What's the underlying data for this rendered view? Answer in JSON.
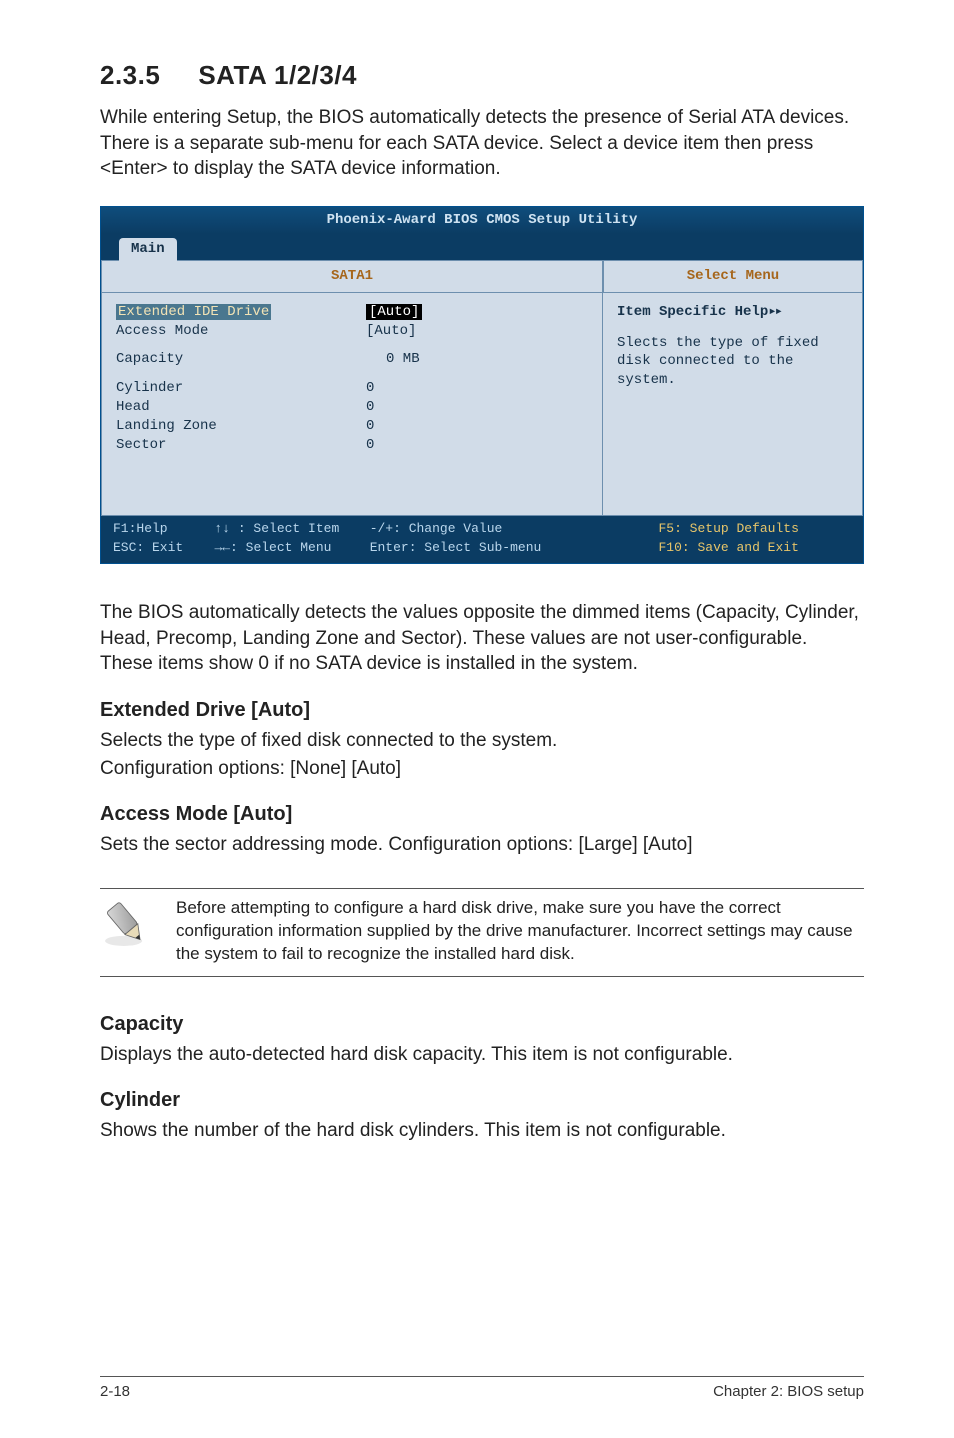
{
  "section": {
    "number": "2.3.5",
    "title": "SATA 1/2/3/4"
  },
  "intro": "While entering Setup, the BIOS automatically detects the presence of Serial ATA devices. There is a separate sub-menu for each SATA device. Select a device item then press <Enter> to display the SATA device information.",
  "bios": {
    "title": "Phoenix-Award BIOS CMOS Setup Utility",
    "tab": "Main",
    "left_header": "SATA1",
    "right_header": "Select Menu",
    "rows": {
      "extended_ide_drive": {
        "label": "Extended IDE Drive",
        "value": "[Auto]"
      },
      "access_mode": {
        "label": "Access Mode",
        "value": "[Auto]"
      },
      "capacity": {
        "label": "Capacity",
        "value": "0 MB"
      },
      "cylinder": {
        "label": "Cylinder",
        "value": "0"
      },
      "head": {
        "label": "Head",
        "value": "0"
      },
      "landing_zone": {
        "label": "Landing Zone",
        "value": "0"
      },
      "sector": {
        "label": "Sector",
        "value": "0"
      }
    },
    "help": {
      "line1": "Item Specific Help",
      "line2": "Slects the type of fixed disk connected to the system."
    },
    "footer": {
      "f1": "F1:Help",
      "select_item": "↑↓ : Select Item",
      "change": "-/+: Change Value",
      "f5": "F5: Setup Defaults",
      "esc": "ESC: Exit",
      "select_menu": "→←: Select Menu",
      "enter": "Enter: Select Sub-menu",
      "f10": "F10: Save and Exit"
    }
  },
  "after_bios": "The BIOS automatically detects the values opposite the dimmed items (Capacity, Cylinder,  Head, Precomp, Landing Zone and Sector). These values are not user-configurable. These items show 0 if no SATA device is installed in the system.",
  "subsections": {
    "extended_drive": {
      "heading": "Extended Drive [Auto]",
      "p1": "Selects the type of fixed disk connected to the system.",
      "p2": "Configuration options: [None] [Auto]"
    },
    "access_mode": {
      "heading": "Access Mode [Auto]",
      "p1": "Sets the sector addressing mode. Configuration options: [Large] [Auto]"
    },
    "capacity": {
      "heading": "Capacity",
      "p1": "Displays the auto-detected hard disk capacity. This item is not configurable."
    },
    "cylinder": {
      "heading": "Cylinder",
      "p1": "Shows the number of the hard disk cylinders. This item is not configurable."
    }
  },
  "note": "Before attempting to configure a hard disk drive, make sure you have the correct configuration information supplied by the drive manufacturer. Incorrect settings may cause the system to fail to recognize the installed hard disk.",
  "footer": {
    "left": "2-18",
    "right": "Chapter 2: BIOS setup"
  }
}
